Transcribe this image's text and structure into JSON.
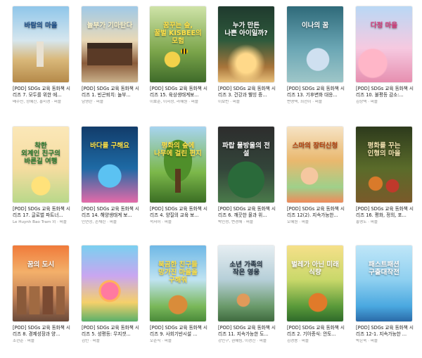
{
  "books": [
    {
      "cover_title": "바람의 마을",
      "title": "[POD] SDGs 교육 동화책 시리즈 7. 모두를 위한 에...",
      "meta": "배수민, 정혜진, 홍미경 · 퍼플"
    },
    {
      "cover_title": "놀부가 기마탄다",
      "title": "[POD] SDGs 교육 동화책 시리즈 1. 빈곤퇴치: 놀부...",
      "meta": "남영란 · 퍼플"
    },
    {
      "cover_title": "꿈꾸는 숲,\n꿀벌 KISBEE의 모험",
      "title": "[POD] SDGs 교육 동화책 시리즈 15. 육상생태계보...",
      "meta": "이효순, 이서정, 라혜원 · 퍼플"
    },
    {
      "cover_title": "누가 만든\n나쁜 아이일까?",
      "title": "[POD] SDGs 교육 동화책 시리즈 3. 건강과 웰빙 증...",
      "meta": "이보빈 · 퍼플"
    },
    {
      "cover_title": "이나의 꿈",
      "title": "[POD] SDGs 교육 동화책 시리즈 13. 기후변화 대응...",
      "meta": "변영택, 최선이 · 퍼플"
    },
    {
      "cover_title": "다정 마을",
      "title": "[POD] SDGs 교육 동화책 시리즈 10. 불평등 감소:...",
      "meta": "김상택 · 퍼플"
    },
    {
      "cover_title": "착한\n외계인 친구의\n바른길 여행",
      "title": "[POD] SDGs 교육 동화책 시리즈 17. 글로벌 파트너...",
      "meta": "Le Huynh Bao Tram 외 · 퍼플"
    },
    {
      "cover_title": "바다를 구해요",
      "title": "[POD] SDGs 교육 동화책 시리즈 14. 해양생태계 보...",
      "meta": "민연정, 손채린 · 퍼플"
    },
    {
      "cover_title": "평화의 숲에\n나무에 걸린 편지",
      "title": "[POD] SDGs 교육 동화책 시리즈 4. 양질의 교육 보...",
      "meta": "석서어 · 퍼플"
    },
    {
      "cover_title": "파랍 물방울의 전설",
      "title": "[POD] SDGs 교육 동화책 시리즈 6. 깨끗한 물과 위...",
      "meta": "박민성, 변경해 · 퍼플"
    },
    {
      "cover_title": "스마의 장터신청",
      "title": "[POD] SDGs 교육 동화책 시리즈 12(2). 지속가능한...",
      "meta": "오혜원 · 퍼플"
    },
    {
      "cover_title": "평화를 꾸는\n인형의 마을",
      "title": "[POD] SDGs 교육 동화책 시리즈 16. 평화, 정의, 포...",
      "meta": "홍명도 · 퍼플"
    },
    {
      "cover_title": "꿈의 도시",
      "title": "[POD] SDGs 교육 동화책 시리즈 8. 경제성장과 양...",
      "meta": "조현준 · 퍼플"
    },
    {
      "cover_title": "",
      "title": "[POD] SDGs 교육 동화책 시리즈 5. 성평등: 무지갯...",
      "meta": "김민 · 퍼플"
    },
    {
      "cover_title": "북곰한 친구들\n망가진 마을을\n구해줘",
      "title": "[POD] SDGs 교육 동화책 시리즈 9. 사회기반시설 ...",
      "meta": "오순식 · 퍼플"
    },
    {
      "cover_title": "소년 가족의\n작은 영웅",
      "title": "[POD] SDGs 교육 동화책 시리즈 11. 지속가능한 도...",
      "meta": "강민구, 권혜림, 이경진 · 퍼플"
    },
    {
      "cover_title": "벌레가 아닌 미래 식량",
      "title": "[POD] SDGs 교육 동화책 시리즈 2. 기아종식: 안토...",
      "meta": "김경용 · 퍼플"
    },
    {
      "cover_title": "패스트패션\n구출대작전",
      "title": "[POD] SDGs 교육 동화책 시리즈 12-1. 지속가능한 ...",
      "meta": "박은숙 · 퍼플"
    }
  ]
}
